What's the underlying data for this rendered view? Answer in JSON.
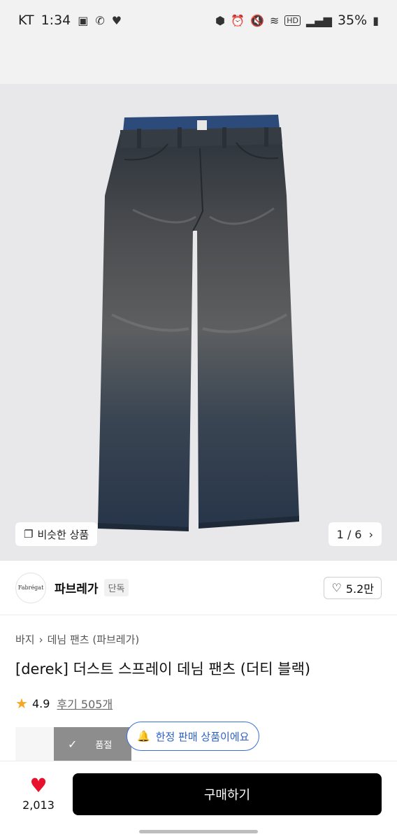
{
  "status_bar": {
    "carrier": "KT",
    "time": "1:34",
    "battery": "35%",
    "left_icons": [
      "image-icon",
      "call-wifi-icon",
      "heart-icon"
    ],
    "right_icons": [
      "android-icon",
      "alarm-icon",
      "mute-icon",
      "wifi-icon",
      "hd-icon",
      "signal-icon",
      "battery-icon"
    ]
  },
  "gallery": {
    "similar_label": "비슷한 상품",
    "counter": "1 / 6"
  },
  "brand": {
    "logo_text": "Fabrégat",
    "name": "파브레가",
    "badge": "단독",
    "likes": "5.2만"
  },
  "breadcrumb": {
    "category": "바지",
    "subcategory": "데님 팬츠 (파브레가)"
  },
  "product": {
    "title": "[derek] 더스트 스프레이 데님 팬츠 (더티 블랙)",
    "rating": "4.9",
    "reviews": "후기 505개"
  },
  "options": {
    "soldout_label": "품절",
    "limited_label": "한정 판매 상품이에요"
  },
  "bottom": {
    "wish_count": "2,013",
    "buy_label": "구매하기"
  },
  "colors": {
    "accent_blue": "#2a5fc9",
    "heart_red": "#e8112d",
    "star_orange": "#f5a623",
    "buy_black": "#000000"
  }
}
